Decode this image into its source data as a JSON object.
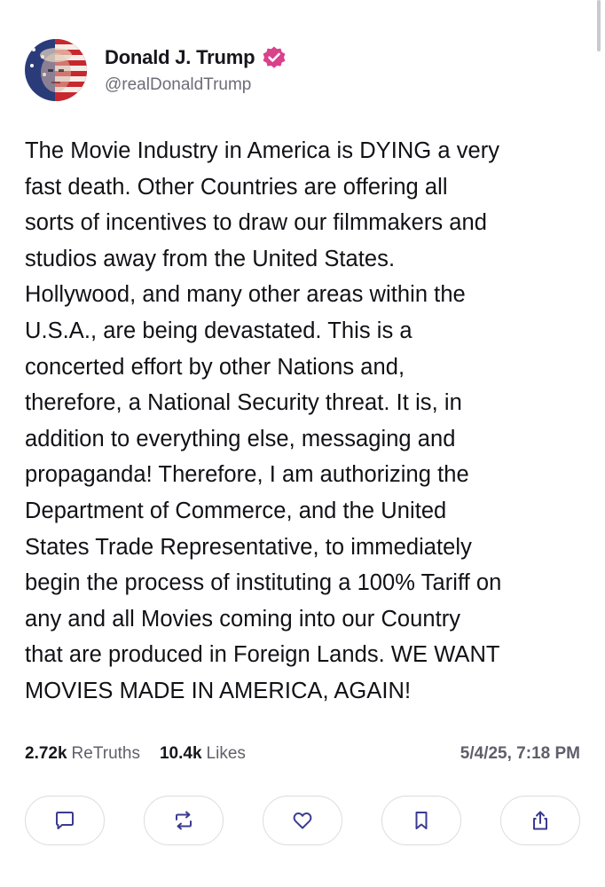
{
  "post": {
    "author": {
      "display_name": "Donald J. Trump",
      "handle": "@realDonaldTrump",
      "verified": true,
      "verified_color": "#d9418a"
    },
    "text": "The Movie Industry in America is DYING a very\nfast death. Other Countries are offering all\nsorts of incentives to draw our filmmakers and\nstudios away from the United States.\nHollywood, and many other areas within the\nU.S.A., are being devastated. This is a\nconcerted effort by other Nations and,\ntherefore, a National Security threat. It is, in\naddition to everything else, messaging and\npropaganda! Therefore, I am authorizing the\nDepartment of Commerce, and the United\nStates Trade Representative, to immediately\nbegin the process of instituting a 100% Tariff on\nany and all Movies coming into our Country\nthat are produced in Foreign Lands. WE WANT\nMOVIES MADE IN AMERICA, AGAIN!",
    "stats": {
      "retruths_count": "2.72k",
      "retruths_label": "ReTruths",
      "likes_count": "10.4k",
      "likes_label": "Likes",
      "timestamp": "5/4/25, 7:18 PM"
    },
    "actions": [
      {
        "name": "reply",
        "icon": "comment-icon"
      },
      {
        "name": "retruth",
        "icon": "repost-icon"
      },
      {
        "name": "like",
        "icon": "heart-icon"
      },
      {
        "name": "bookmark",
        "icon": "bookmark-icon"
      },
      {
        "name": "share",
        "icon": "share-icon"
      }
    ]
  }
}
